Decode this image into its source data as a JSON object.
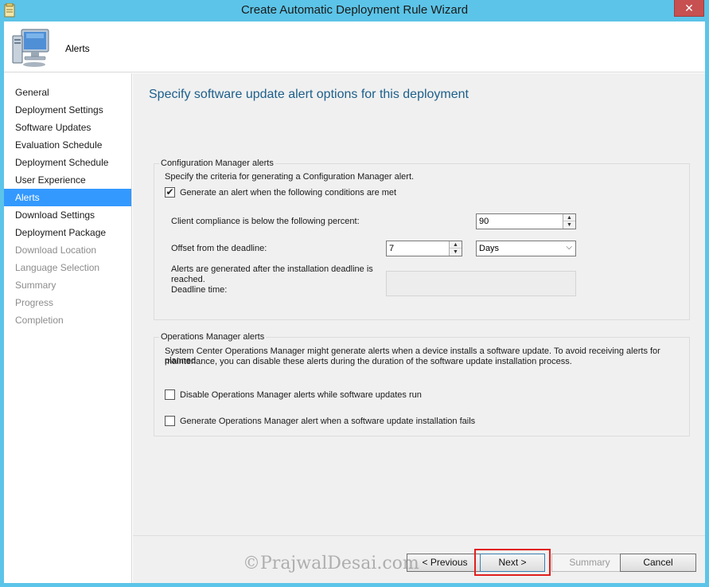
{
  "window": {
    "title": "Create Automatic Deployment Rule Wizard",
    "close_glyph": "✕"
  },
  "header": {
    "title": "Alerts"
  },
  "sidebar": {
    "items": [
      {
        "label": "General",
        "state": "normal"
      },
      {
        "label": "Deployment Settings",
        "state": "normal"
      },
      {
        "label": "Software Updates",
        "state": "normal"
      },
      {
        "label": "Evaluation Schedule",
        "state": "normal"
      },
      {
        "label": "Deployment Schedule",
        "state": "normal"
      },
      {
        "label": "User Experience",
        "state": "normal"
      },
      {
        "label": "Alerts",
        "state": "active"
      },
      {
        "label": "Download Settings",
        "state": "normal"
      },
      {
        "label": "Deployment Package",
        "state": "normal"
      },
      {
        "label": "Download Location",
        "state": "disabled"
      },
      {
        "label": "Language Selection",
        "state": "disabled"
      },
      {
        "label": "Summary",
        "state": "disabled"
      },
      {
        "label": "Progress",
        "state": "disabled"
      },
      {
        "label": "Completion",
        "state": "disabled"
      }
    ]
  },
  "main": {
    "heading": "Specify software update alert options for this deployment",
    "cm_group": {
      "title": "Configuration Manager alerts",
      "description": "Specify the criteria for generating a Configuration Manager alert.",
      "generate_checkbox": {
        "label": "Generate an alert when the following conditions are met",
        "checked": true,
        "glyph": "✔"
      },
      "compliance_label": "Client compliance is below the  following percent:",
      "compliance_value": "90",
      "offset_label": "Offset from the deadline:",
      "offset_value": "7",
      "offset_unit": "Days",
      "deadline_note_line1": "Alerts are generated after the installation deadline is",
      "deadline_note_line2": "reached.",
      "deadline_time_label": "Deadline time:",
      "deadline_time_value": ""
    },
    "om_group": {
      "title": "Operations Manager alerts",
      "description_line1": "System Center Operations Manager might generate alerts when a device installs a software update. To avoid receiving alerts for planned",
      "description_line2": "maintenance, you can disable these alerts during the duration of the software update installation process.",
      "disable_checkbox": {
        "label": "Disable Operations Manager alerts while software updates run",
        "checked": false
      },
      "generate_checkbox": {
        "label": "Generate Operations Manager alert when a software update installation fails",
        "checked": false
      }
    }
  },
  "footer": {
    "previous_label": "< Previous",
    "next_label": "Next >",
    "summary_label": "Summary",
    "cancel_label": "Cancel"
  },
  "watermark": "©PrajwalDesai.com",
  "colors": {
    "titlebar": "#5cc4e8",
    "active_nav": "#3399ff",
    "heading": "#1d5f8a",
    "highlight": "#e0201e",
    "close_button": "#c75050"
  }
}
